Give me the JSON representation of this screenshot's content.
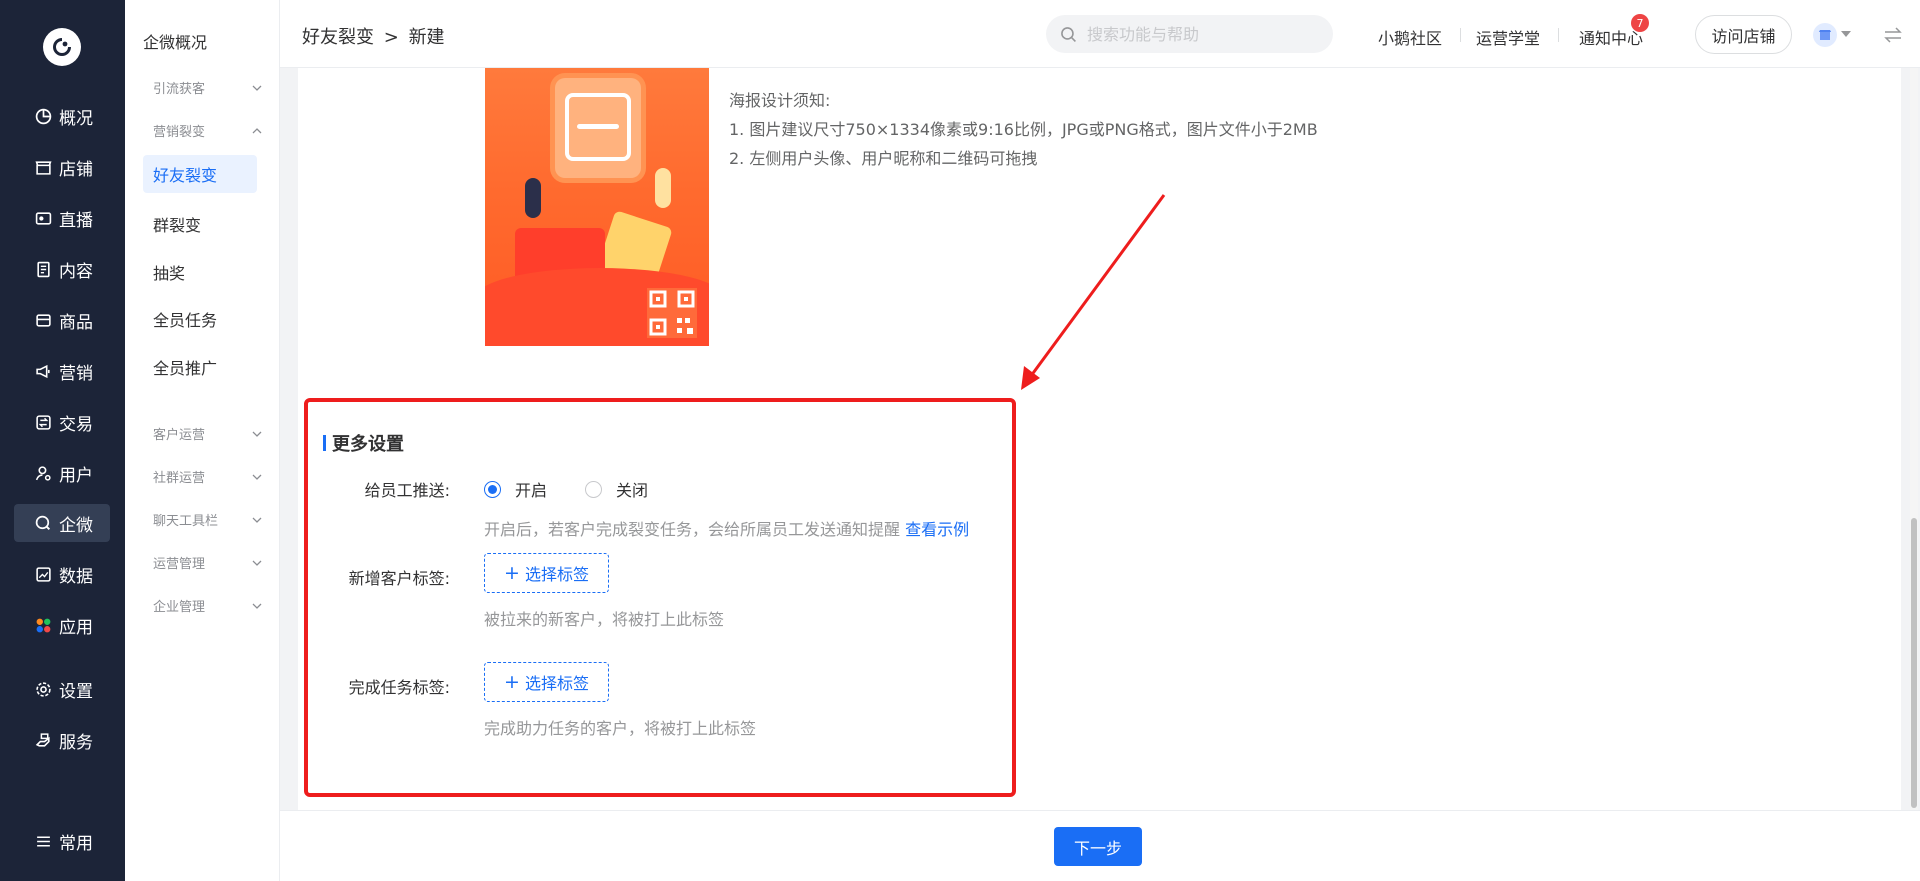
{
  "rail": {
    "items": [
      {
        "label": "概况",
        "icon": "pie-chart-icon"
      },
      {
        "label": "店铺",
        "icon": "store-icon"
      },
      {
        "label": "直播",
        "icon": "live-icon"
      },
      {
        "label": "内容",
        "icon": "document-icon"
      },
      {
        "label": "商品",
        "icon": "product-icon"
      },
      {
        "label": "营销",
        "icon": "megaphone-icon"
      },
      {
        "label": "交易",
        "icon": "trade-icon"
      },
      {
        "label": "用户",
        "icon": "user-icon"
      },
      {
        "label": "企微",
        "icon": "wecom-icon"
      },
      {
        "label": "数据",
        "icon": "data-icon"
      },
      {
        "label": "应用",
        "icon": "apps-icon"
      },
      {
        "label": "设置",
        "icon": "settings-icon"
      },
      {
        "label": "服务",
        "icon": "service-icon"
      },
      {
        "label": "常用",
        "icon": "list-icon"
      }
    ],
    "active": "企微"
  },
  "subnav": {
    "overview": "企微概况",
    "group_lead": "引流获客",
    "group_marketing": "营销裂变",
    "marketing_items": [
      "好友裂变",
      "群裂变",
      "抽奖",
      "全员任务",
      "全员推广"
    ],
    "active": "好友裂变",
    "groups_bottom": [
      "客户运营",
      "社群运营",
      "聊天工具栏",
      "运营管理",
      "企业管理"
    ]
  },
  "header": {
    "breadcrumb_parent": "好友裂变",
    "breadcrumb_sep": ">",
    "breadcrumb_current": "新建",
    "search_placeholder": "搜索功能与帮助",
    "links": [
      "小鹅社区",
      "运营学堂",
      "通知中心"
    ],
    "notification_count": "7",
    "visit_store": "访问店铺"
  },
  "poster_tips": {
    "title": "海报设计须知:",
    "line1": "1. 图片建议尺寸750×1334像素或9:16比例，JPG或PNG格式，图片文件小于2MB",
    "line2": "2. 左侧用户头像、用户昵称和二维码可拖拽"
  },
  "more_settings": {
    "title": "更多设置",
    "push_label": "给员工推送:",
    "push_on": "开启",
    "push_off": "关闭",
    "push_selected": "开启",
    "push_hint": "开启后，若客户完成裂变任务，会给所属员工发送通知提醒",
    "push_example": "查看示例",
    "new_tag_label": "新增客户标签:",
    "new_tag_button": "选择标签",
    "new_tag_hint": "被拉来的新客户，将被打上此标签",
    "done_tag_label": "完成任务标签:",
    "done_tag_button": "选择标签",
    "done_tag_hint": "完成助力任务的客户，将被打上此标签"
  },
  "footer": {
    "next": "下一步"
  },
  "colors": {
    "primary": "#1a6ef5",
    "rail_bg": "#1c2438",
    "highlight_border": "#ee1d1d"
  }
}
